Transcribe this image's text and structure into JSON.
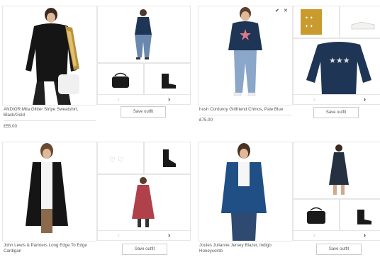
{
  "outfits": [
    {
      "product_title": "ANDIOR Mila Glitter Stripe Sweatshirt, Black/Gold",
      "price": "£55.00",
      "save_label": "Save outfit",
      "nav_prev": "‹",
      "nav_next": "›"
    },
    {
      "product_title": "hush Corduroy Girlfriend Chinos, Pale Blue",
      "price": "£75.00",
      "save_label": "Save outfit",
      "nav_prev": "‹",
      "nav_next": "›",
      "check_icon": "✔",
      "close_icon": "✕"
    },
    {
      "product_title": "John Lewis & Partners Long Edge To Edge Cardigan",
      "price": "",
      "save_label": "Save outfit",
      "nav_prev": "‹",
      "nav_next": "›"
    },
    {
      "product_title": "Joules Julianne Jersey Blazer, Indigo Honeycomb",
      "price": "",
      "save_label": "Save outfit",
      "nav_prev": "‹",
      "nav_next": "›"
    }
  ],
  "colors": {
    "border": "#e6e6e6",
    "text": "#555555",
    "gold": "#c99a2e",
    "navy": "#1e3555",
    "blazer": "#1f4f85"
  }
}
